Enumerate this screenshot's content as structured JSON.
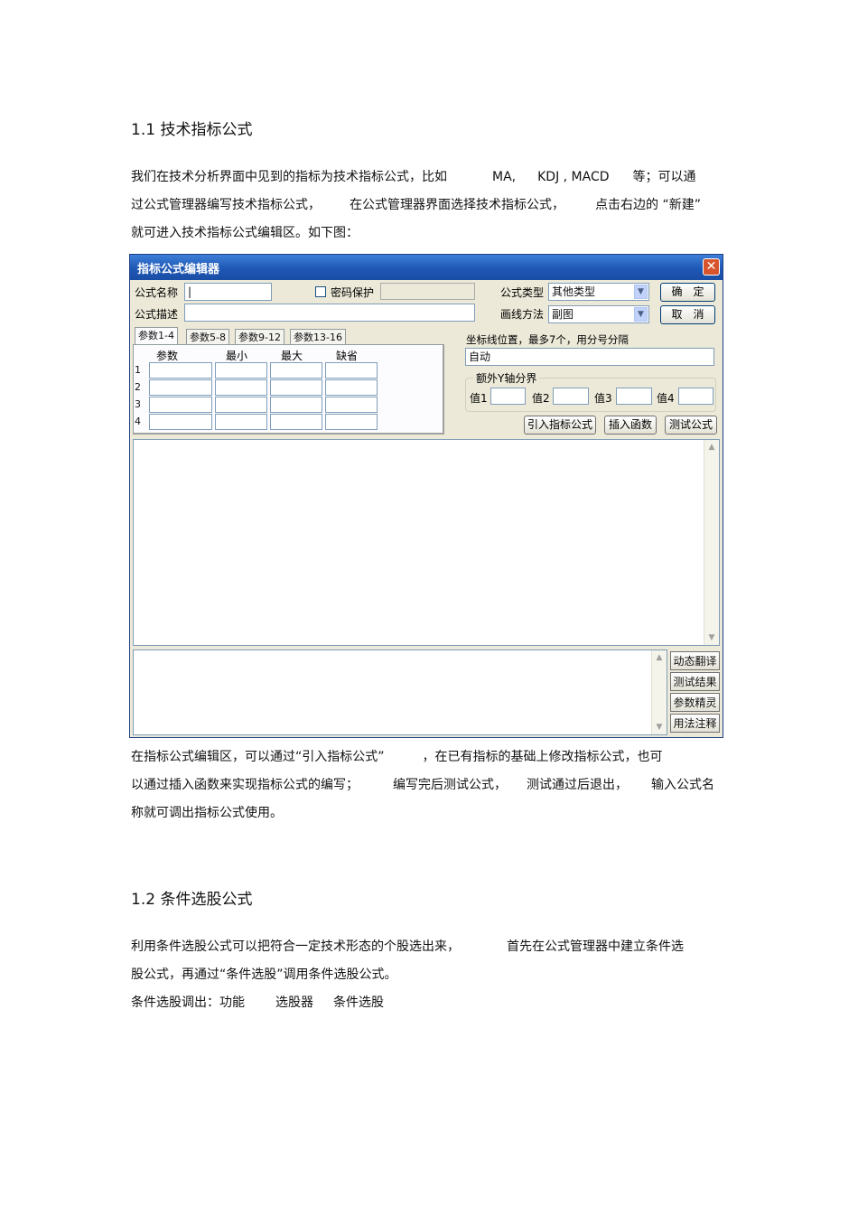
{
  "section1": {
    "heading": "1.1 技术指标公式",
    "para1": {
      "line1": [
        "我们在技术分析界面中见到的指标为技术指标公式，比如",
        "MA,",
        "KDJ , MACD",
        "等；可以通",
        ""
      ],
      "line2": [
        "过公式管理器编写技术指标公式，",
        "在公式管理器界面选择技术指标公式，",
        "点击右边的 “新建”"
      ],
      "line3": "就可进入技术指标公式编辑区。如下图："
    },
    "para2": {
      "line1": [
        "在指标公式编辑区，可以通过“引入指标公式”",
        "，在已有指标的基础上修改指标公式，也可"
      ],
      "line2": [
        "以通过插入函数来实现指标公式的编写；",
        "编写完后测试公式，",
        "测试通过后退出，",
        "输入公式名"
      ],
      "line3": "称就可调出指标公式使用。"
    }
  },
  "section2": {
    "heading": "1.2 条件选股公式",
    "para1": {
      "line1": [
        "利用条件选股公式可以把符合一定技术形态的个股选出来，",
        "首先在公式管理器中建立条件选"
      ],
      "line2": "股公式，再通过“条件选股”调用条件选股公式。",
      "line3": [
        "条件选股调出：功能",
        "选股器",
        "条件选股"
      ]
    }
  },
  "dialog": {
    "title": "指标公式编辑器",
    "close_glyph": "✕",
    "formula_name_label": "公式名称",
    "formula_name_value": "|",
    "password_label": "密码保护",
    "formula_desc_label": "公式描述",
    "formula_type_label": "公式类型",
    "formula_type_value": "其他类型",
    "draw_method_label": "画线方法",
    "draw_method_value": "副图",
    "ok_button": "确　定",
    "cancel_button": "取　消",
    "tabs": [
      "参数1-4",
      "参数5-8",
      "参数9-12",
      "参数13-16"
    ],
    "param_headers": [
      "参数",
      "最小",
      "最大",
      "缺省"
    ],
    "param_rows": [
      "1",
      "2",
      "3",
      "4"
    ],
    "coord_label": "坐标线位置，最多7个，用分号分隔",
    "coord_value": "自动",
    "yaxis_group_label": "额外Y轴分界",
    "value_labels": [
      "值1",
      "值2",
      "值3",
      "值4"
    ],
    "import_button": "引入指标公式",
    "insert_func_button": "插入函数",
    "test_formula_button": "测试公式",
    "side_buttons": [
      "动态翻译",
      "测试结果",
      "参数精灵",
      "用法注释"
    ],
    "arrow_up": "▲",
    "arrow_down": "▼",
    "combo_arrow": "▼"
  }
}
